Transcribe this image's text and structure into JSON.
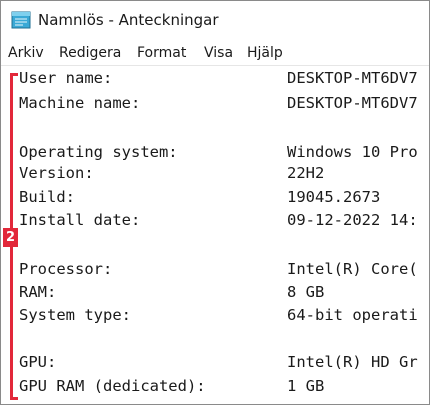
{
  "window": {
    "title": "Namnlös - Anteckningar"
  },
  "menu": [
    "Arkiv",
    "Redigera",
    "Format",
    "Visa",
    "Hjälp"
  ],
  "annotation": {
    "badge": "2",
    "color": "#e2283a"
  },
  "lines": [
    {
      "label": "User name:",
      "value": "DESKTOP-MT6DV7"
    },
    {
      "label": "Machine name:",
      "value": "DESKTOP-MT6DV7"
    },
    {
      "label": "Operating system:",
      "value": "Windows 10 Pro"
    },
    {
      "label": "Version:",
      "value": "22H2"
    },
    {
      "label": "Build:",
      "value": "19045.2673"
    },
    {
      "label": "Install date:",
      "value": "09-12-2022 14:"
    },
    {
      "label": "Processor:",
      "value": "Intel(R) Core("
    },
    {
      "label": "RAM:",
      "value": "8 GB"
    },
    {
      "label": "System type:",
      "value": "64-bit operati"
    },
    {
      "label": "GPU:",
      "value": "Intel(R) HD Gr"
    },
    {
      "label": "GPU RAM (dedicated):",
      "value": "1 GB"
    }
  ]
}
